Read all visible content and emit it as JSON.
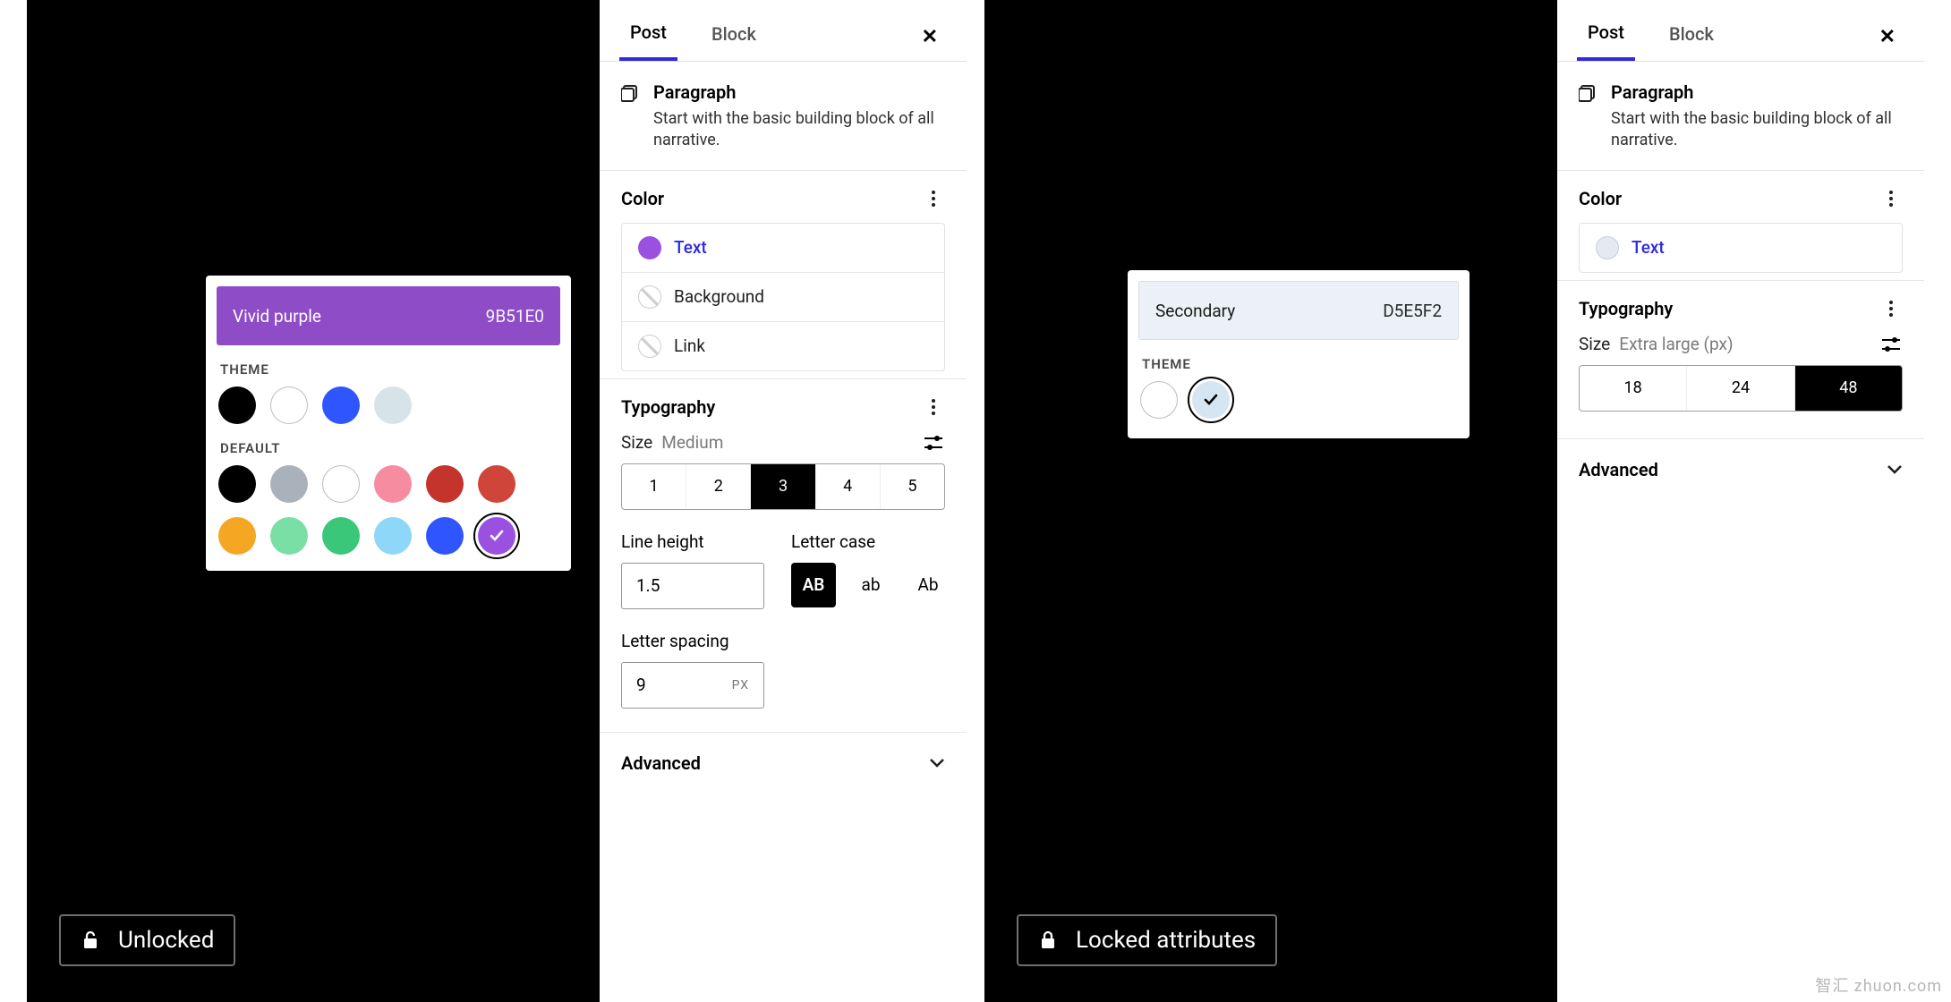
{
  "left": {
    "tabs": {
      "post": "Post",
      "block": "Block"
    },
    "block": {
      "title": "Paragraph",
      "desc": "Start with the basic building block of all narrative."
    },
    "color": {
      "heading": "Color",
      "items": [
        {
          "label": "Text",
          "kind": "purple",
          "active": true
        },
        {
          "label": "Background",
          "kind": "hollow",
          "active": false
        },
        {
          "label": "Link",
          "kind": "hollow",
          "active": false
        }
      ]
    },
    "typography": {
      "heading": "Typography",
      "size_label": "Size",
      "size_value": "Medium",
      "presets": [
        "1",
        "2",
        "3",
        "4",
        "5"
      ],
      "active_preset": 2,
      "line_height": {
        "label": "Line height",
        "value": "1.5"
      },
      "letter_case": {
        "label": "Letter case",
        "options": [
          "AB",
          "ab",
          "Ab"
        ],
        "active": 0
      },
      "letter_spacing": {
        "label": "Letter spacing",
        "value": "9",
        "unit": "PX"
      }
    },
    "advanced": "Advanced",
    "lock_badge": "Unlocked",
    "popover": {
      "name": "Vivid purple",
      "hex": "9B51E0",
      "theme_label": "THEME",
      "theme": [
        "#000000",
        "#ffffff",
        "#2f55ff",
        "#d6e4ea"
      ],
      "default_label": "DEFAULT",
      "default": [
        "#000000",
        "#a9b2bb",
        "#ffffff",
        "#f58ca0",
        "#c4342d",
        "#d0453a",
        "#f5a623",
        "#7adfa5",
        "#3bc77a",
        "#8fd7f8",
        "#2f55ff",
        "#9b51e0"
      ],
      "selected_index": 11
    }
  },
  "right": {
    "tabs": {
      "post": "Post",
      "block": "Block"
    },
    "block": {
      "title": "Paragraph",
      "desc": "Start with the basic building block of all narrative."
    },
    "color": {
      "heading": "Color",
      "items": [
        {
          "label": "Text",
          "kind": "pale",
          "active": true
        }
      ]
    },
    "typography": {
      "heading": "Typography",
      "size_label": "Size",
      "size_value": "Extra large (px)",
      "presets": [
        "18",
        "24",
        "48"
      ],
      "active_preset": 2
    },
    "advanced": "Advanced",
    "lock_badge": "Locked attributes",
    "popover": {
      "name": "Secondary",
      "hex": "D5E5F2",
      "theme_label": "THEME",
      "theme": [
        "#ffffff",
        "#d5e5f2"
      ],
      "selected_index": 1
    }
  },
  "watermark": "智汇 zhuon.com"
}
